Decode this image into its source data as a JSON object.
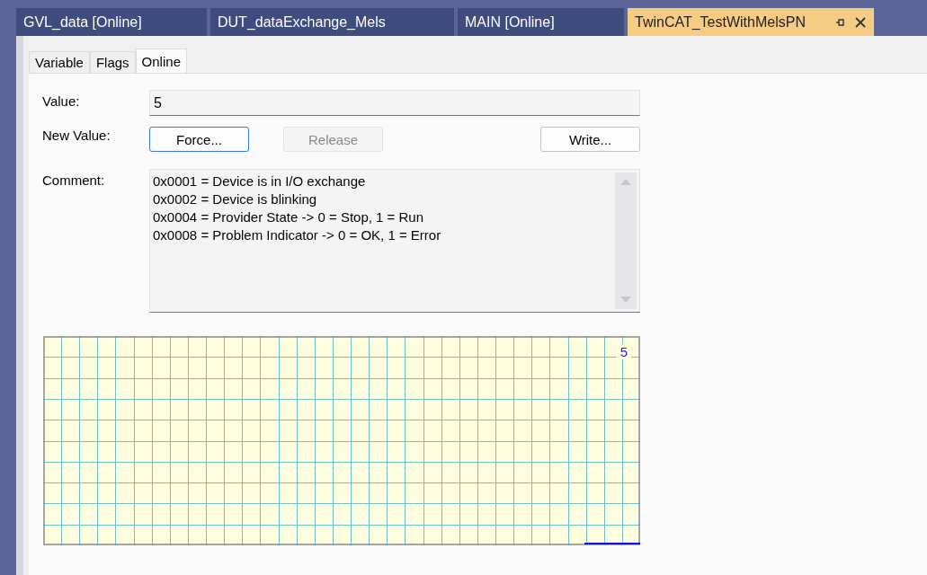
{
  "document_tabs": [
    {
      "label": "GVL_data [Online]",
      "selected": false
    },
    {
      "label": "DUT_dataExchange_Mels",
      "selected": false
    },
    {
      "label": "MAIN [Online]",
      "selected": false
    },
    {
      "label": "TwinCAT_TestWithMelsPN",
      "selected": true
    }
  ],
  "inner_tabs": [
    {
      "label": "Variable",
      "selected": false
    },
    {
      "label": "Flags",
      "selected": false
    },
    {
      "label": "Online",
      "selected": true
    }
  ],
  "value": {
    "label": "Value:",
    "text": "5"
  },
  "new_value": {
    "label": "New Value:",
    "buttons": [
      {
        "label": "Force...",
        "disabled": false,
        "focused": true
      },
      {
        "label": "Release",
        "disabled": true,
        "focused": false
      },
      {
        "label": "Write...",
        "disabled": false,
        "focused": false
      }
    ]
  },
  "comment": {
    "label": "Comment:",
    "lines": [
      "0x0001 = Device is in I/O exchange",
      "0x0002 = Device is blinking",
      "0x0004 = Provider State -> 0 = Stop, 1 = Run",
      "0x0008 = Problem Indicator -> 0 = OK, 1 = Error"
    ]
  },
  "trend": {
    "current_value": "5"
  }
}
